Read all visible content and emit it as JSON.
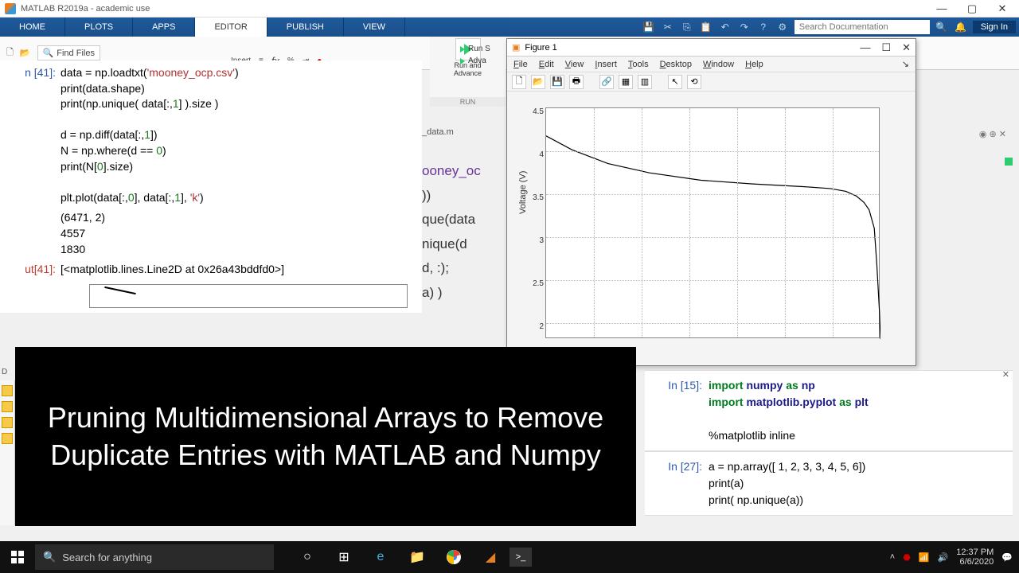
{
  "titlebar": {
    "title": "MATLAB R2019a - academic use"
  },
  "ribbon": {
    "tabs": [
      "HOME",
      "PLOTS",
      "APPS",
      "EDITOR",
      "PUBLISH",
      "VIEW"
    ],
    "active": "EDITOR",
    "search_placeholder": "Search Documentation",
    "signin": "Sign In"
  },
  "toolstrip": {
    "find_files": "Find Files",
    "insert": "Insert",
    "fx": "fx"
  },
  "run": {
    "big_label": "Run and\nAdvance",
    "side1": "Run S",
    "side2": "Adva",
    "footer": "RUN"
  },
  "jupyter_left": {
    "in_label": "n [41]:",
    "out_label": "ut[41]:",
    "code": "data = np.loadtxt('mooney_ocp.csv')\nprint(data.shape)\nprint(np.unique( data[:,1] ).size )\n\nd = np.diff(data[:,1])\nN = np.where(d == 0)\nprint(N[0].size)\n\nplt.plot(data[:,0], data[:,1], 'k')",
    "stdout": "(6471, 2)\n4557\n1830",
    "out_repr": "[<matplotlib.lines.Line2D at 0x26a43bddfd0>]"
  },
  "ml_editor": {
    "tab": "_data.m",
    "lines": [
      "ooney_oc",
      "))",
      "que(data",
      "",
      "nique(d",
      "d, :);",
      "a) )"
    ]
  },
  "figure": {
    "title": "Figure 1",
    "menus": [
      "File",
      "Edit",
      "View",
      "Insert",
      "Tools",
      "Desktop",
      "Window",
      "Help"
    ],
    "ylabel": "Voltage (V)",
    "yticks": [
      "2",
      "2.5",
      "3",
      "3.5",
      "4",
      "4.5"
    ]
  },
  "chart_data": {
    "type": "line",
    "title": "",
    "xlabel": "",
    "ylabel": "Voltage (V)",
    "ylim": [
      2,
      4.5
    ],
    "x_range": [
      0,
      6470
    ],
    "series": [
      {
        "name": "k",
        "x": [
          0,
          500,
          1200,
          2000,
          3000,
          4000,
          5000,
          5500,
          5800,
          6000,
          6150,
          6250,
          6350,
          6400,
          6450,
          6470
        ],
        "y": [
          4.2,
          4.05,
          3.9,
          3.8,
          3.72,
          3.68,
          3.65,
          3.63,
          3.6,
          3.55,
          3.48,
          3.4,
          3.2,
          2.8,
          2.3,
          2.0
        ]
      }
    ]
  },
  "caption": "Pruning Multidimensional Arrays to Remove Duplicate Entries with MATLAB and Numpy",
  "jupyter_right": {
    "cells": [
      {
        "label": "In [15]:",
        "code": "import numpy as np\nimport matplotlib.pyplot as plt\n\n%matplotlib inline"
      },
      {
        "label": "In [27]:",
        "code": "a = np.array([ 1, 2, 3, 3, 4, 5, 6])\nprint(a)\nprint( np.unique(a))"
      }
    ]
  },
  "taskbar": {
    "search_placeholder": "Search for anything",
    "time": "12:37 PM",
    "date": "6/6/2020"
  }
}
